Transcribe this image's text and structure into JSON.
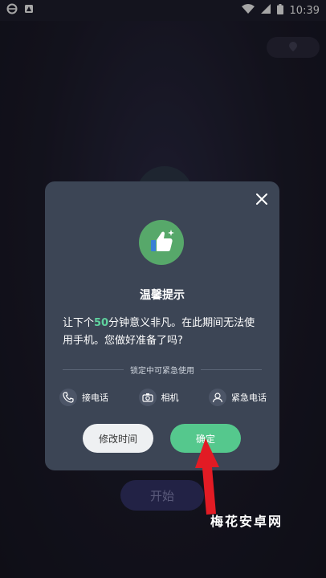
{
  "status_bar": {
    "time": "10:39"
  },
  "background": {
    "start_button": "开始"
  },
  "dialog": {
    "title": "温馨提示",
    "message": {
      "before": "让下个",
      "minutes": "50",
      "after": "分钟意义非凡。在此期间无法使用手机。您做好准备了吗?"
    },
    "divider_label": "锁定中可紧急使用",
    "features": [
      {
        "label": "接电话",
        "icon": "phone-icon"
      },
      {
        "label": "相机",
        "icon": "camera-icon"
      },
      {
        "label": "紧急电话",
        "icon": "person-icon"
      }
    ],
    "buttons": {
      "modify": "修改时间",
      "confirm": "确定"
    }
  },
  "watermark": "梅花安卓网",
  "colors": {
    "accent": "#55c88d",
    "highlight": "#5fd29e",
    "dialog_bg": "#3c4555",
    "arrow": "#e21b24"
  }
}
